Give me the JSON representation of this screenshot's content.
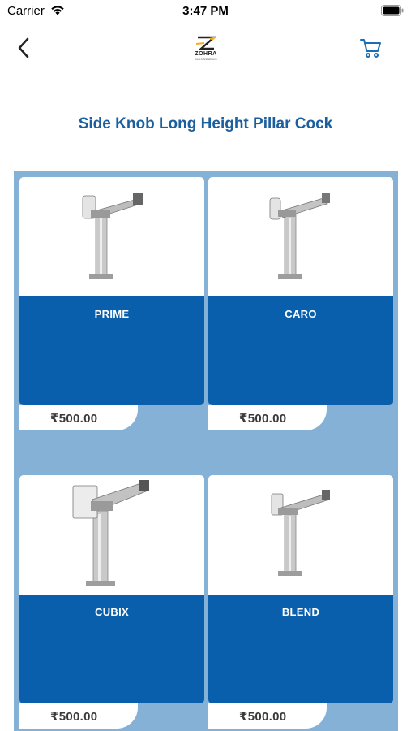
{
  "status_bar": {
    "carrier": "Carrier",
    "time": "3:47 PM"
  },
  "nav": {
    "back_icon": "chevron-left-icon",
    "logo_text": "ZOHRA",
    "logo_tagline": "www.zohrabath.com",
    "cart_icon": "cart-icon",
    "accent_color": "#1b5f9e"
  },
  "page": {
    "title": "Side Knob Long Height Pillar Cock"
  },
  "colors": {
    "grid_background": "#85b1d6",
    "card_body": "#0a5fac",
    "title": "#1b5f9e"
  },
  "products": [
    {
      "name": "PRIME",
      "price": "₹500.00"
    },
    {
      "name": "CARO",
      "price": "₹500.00"
    },
    {
      "name": "CUBIX",
      "price": "₹500.00"
    },
    {
      "name": "BLEND",
      "price": "₹500.00"
    }
  ]
}
